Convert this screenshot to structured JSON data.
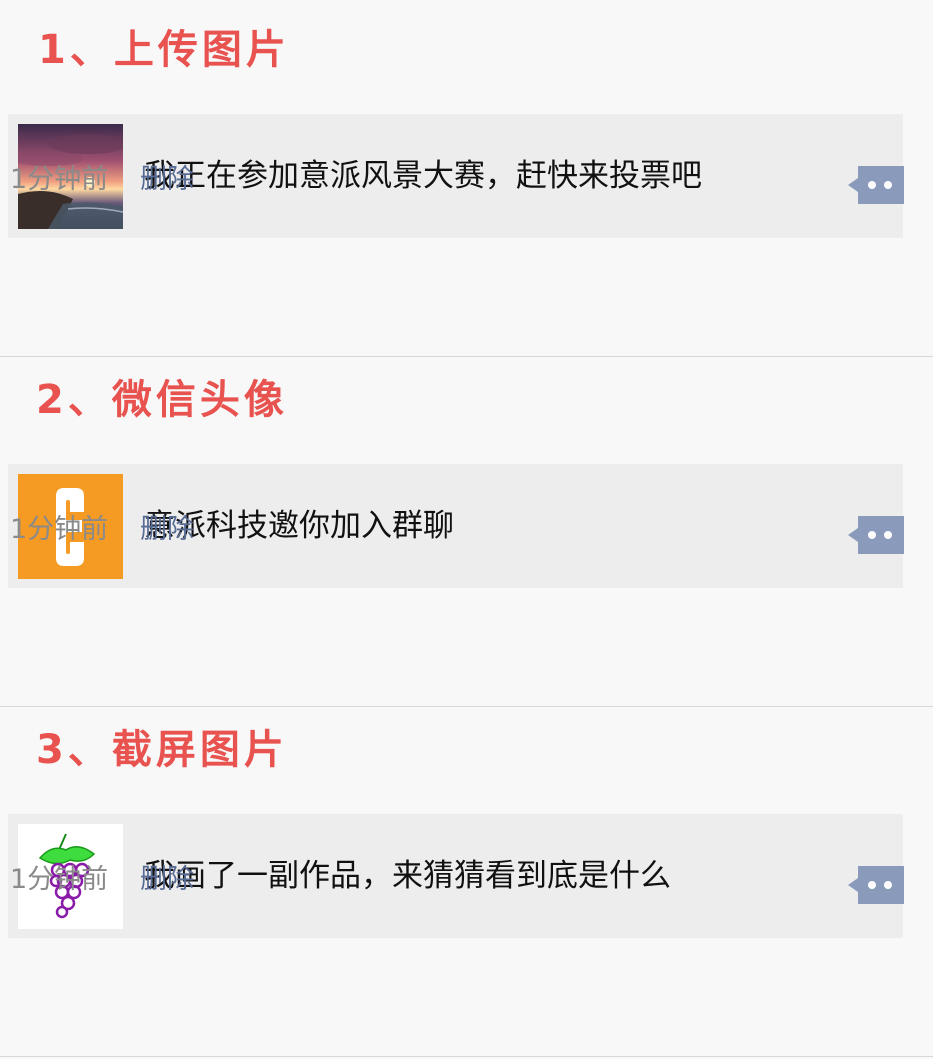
{
  "sections": [
    {
      "heading": "1、上传图片",
      "thumb_icon": "sunset-seascape-photo",
      "text": "我正在参加意派风景大赛，赶快来投票吧",
      "time": "1分钟前",
      "delete_label": "删除",
      "comment_icon": "comment-bubble-icon"
    },
    {
      "heading": "2、微信头像",
      "thumb_icon": "orange-e-logo",
      "text": "意派科技邀你加入群聊",
      "time": "1分钟前",
      "delete_label": "删除",
      "comment_icon": "comment-bubble-icon"
    },
    {
      "heading": "3、截屏图片",
      "thumb_icon": "grape-drawing",
      "text": "我画了一副作品，来猜猜看到底是什么",
      "time": "1分钟前",
      "delete_label": "删除",
      "comment_icon": "comment-bubble-icon"
    }
  ],
  "colors": {
    "heading": "#e8524f",
    "link": "#576b95",
    "card_bg": "#ededed",
    "page_bg": "#f8f8f8",
    "comment_btn": "#8a9abb",
    "logo_orange": "#f59a23"
  }
}
